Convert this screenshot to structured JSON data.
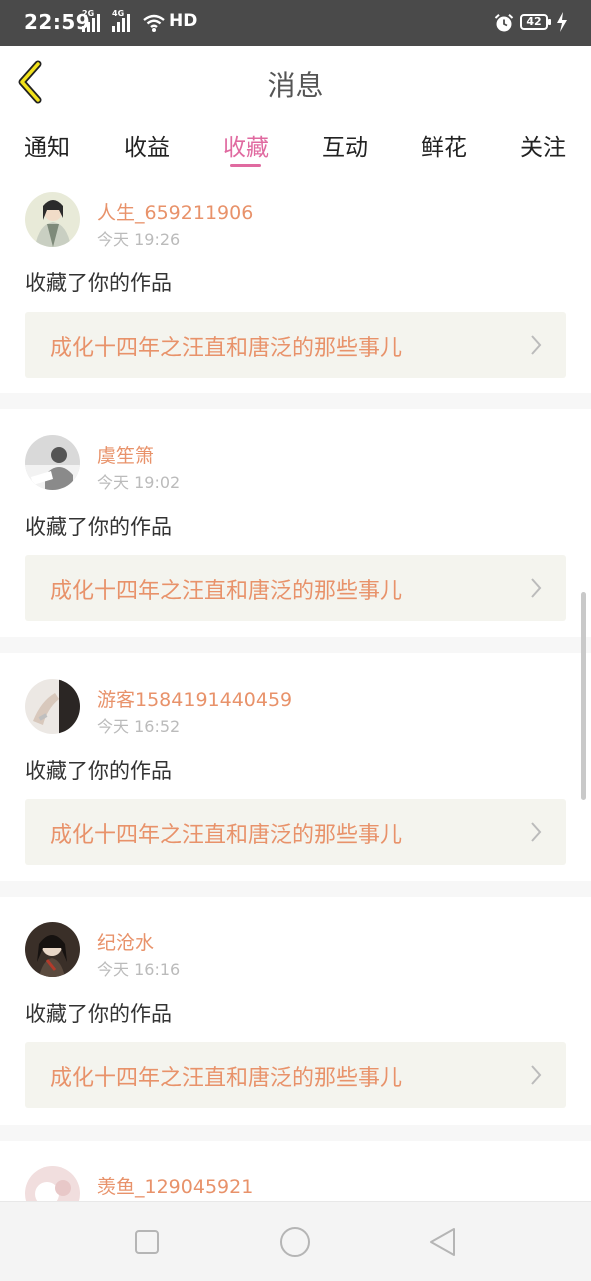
{
  "status_bar": {
    "time": "22:59",
    "signal1_label": "2G",
    "signal2_label": "4G",
    "network_label": "HD",
    "battery_level": "42",
    "icons": [
      "wifi-icon",
      "alarm-icon",
      "battery-icon",
      "charging-icon"
    ]
  },
  "header": {
    "title": "消息",
    "back_icon": "chevron-left-icon"
  },
  "tabs": {
    "items": [
      "通知",
      "收益",
      "收藏",
      "互动",
      "鲜花",
      "关注"
    ],
    "active_index": 2
  },
  "colors": {
    "accent_pink": "#e06aa0",
    "username_orange": "#e8926a",
    "work_box_bg": "#f4f4ee"
  },
  "notifications": [
    {
      "username": "人生_659211906",
      "time": "今天 19:26",
      "action": "收藏了你的作品",
      "work_title": "成化十四年之汪直和唐泛的那些事儿"
    },
    {
      "username": "虞笙箫",
      "time": "今天 19:02",
      "action": "收藏了你的作品",
      "work_title": "成化十四年之汪直和唐泛的那些事儿"
    },
    {
      "username": "游客1584191440459",
      "time": "今天 16:52",
      "action": "收藏了你的作品",
      "work_title": "成化十四年之汪直和唐泛的那些事儿"
    },
    {
      "username": "纪沧水",
      "time": "今天 16:16",
      "action": "收藏了你的作品",
      "work_title": "成化十四年之汪直和唐泛的那些事儿"
    },
    {
      "username": "羡鱼_129045921"
    }
  ],
  "nav_bar": {
    "buttons": [
      "recents-square-icon",
      "home-circle-icon",
      "back-triangle-icon"
    ]
  }
}
